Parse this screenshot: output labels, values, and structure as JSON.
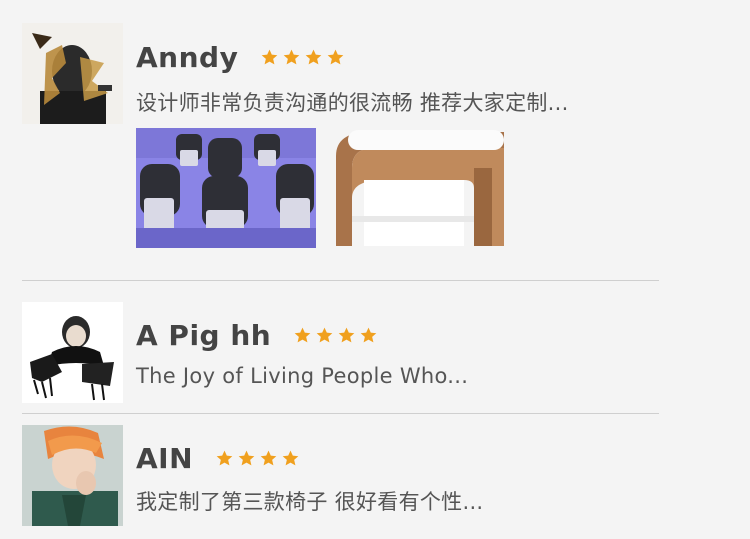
{
  "reviews": [
    {
      "name": "Anndy",
      "rating": 4,
      "comment": "设计师非常负责沟通的很流畅 推荐大家定制...",
      "photos": [
        "chairs-photo",
        "side-table-photo"
      ]
    },
    {
      "name": "A Pig hh",
      "rating": 4,
      "comment": "The Joy of Living People Who..."
    },
    {
      "name": "AIN",
      "rating": 4,
      "comment": "我定制了第三款椅子 很好看有个性..."
    }
  ],
  "colors": {
    "star": "#f0a01e",
    "divider": "#cfcfcf",
    "background": "#f4f4f4"
  }
}
